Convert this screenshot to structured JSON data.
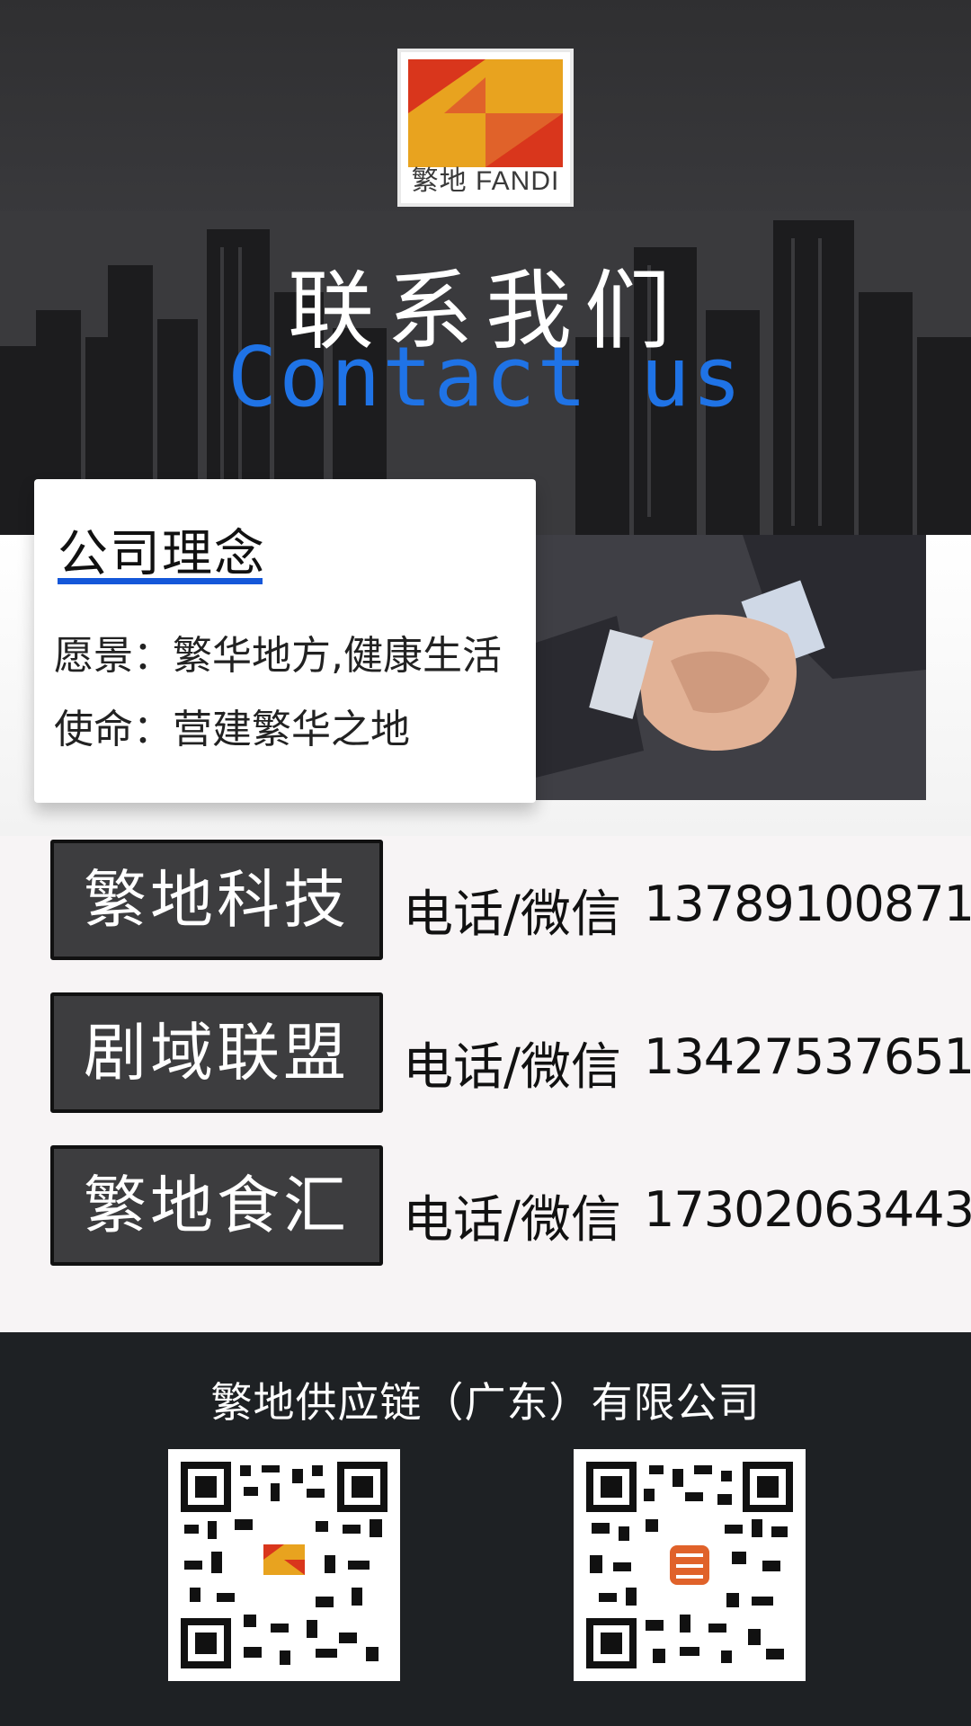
{
  "logo": {
    "text": "繁地 FANDI"
  },
  "header": {
    "title_cn": "联系我们",
    "title_en": "Contact us"
  },
  "concept": {
    "heading": "公司理念",
    "vision": "愿景：繁华地方,健康生活",
    "mission": "使命：营建繁华之地"
  },
  "contacts": [
    {
      "brand": "繁地科技",
      "label": "电话/微信",
      "phone": "13789100871"
    },
    {
      "brand": "剧域联盟",
      "label": "电话/微信",
      "phone": "13427537651"
    },
    {
      "brand": "繁地食汇",
      "label": "电话/微信",
      "phone": "17302063443"
    }
  ],
  "footer": {
    "company": "繁地供应链（广东）有限公司",
    "qr_codes": [
      {
        "icon": "qr-code-fandi-icon"
      },
      {
        "icon": "qr-code-juyu-icon"
      }
    ]
  },
  "colors": {
    "accent_blue": "#1f73e6",
    "underline_blue": "#1457d9",
    "logo_orange": "#e8a31f",
    "logo_red": "#d9361c",
    "footer_bg": "#1e2124",
    "brand_box_bg": "#3d3d3f"
  }
}
